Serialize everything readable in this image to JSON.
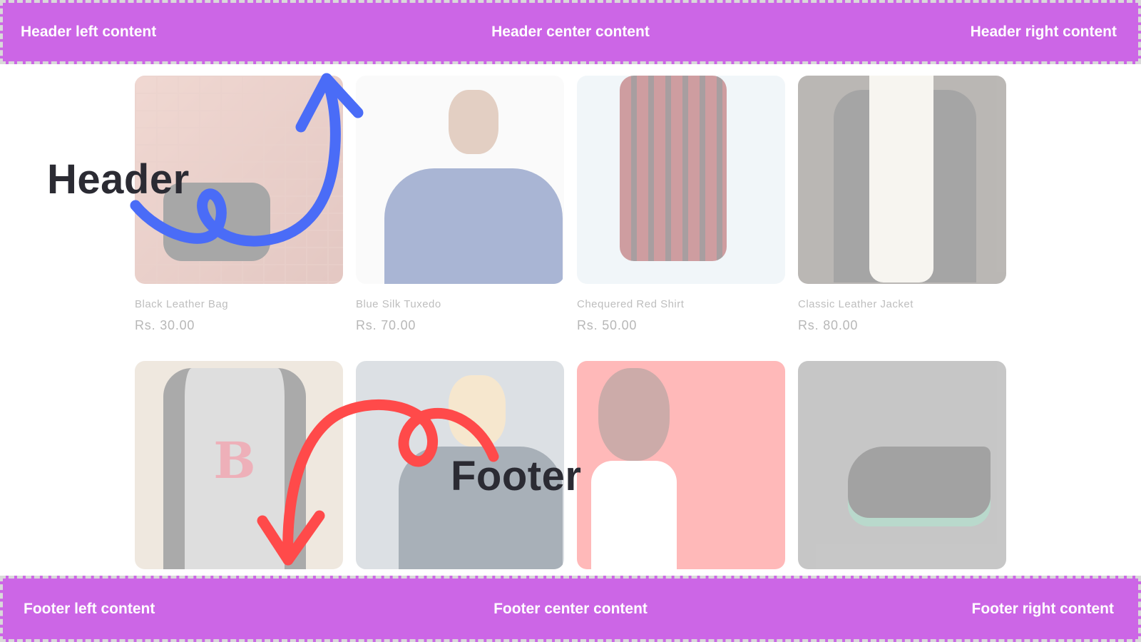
{
  "header": {
    "left": "Header left content",
    "center": "Header center content",
    "right": "Header right content",
    "label": "Header"
  },
  "footer": {
    "left": "Footer left content",
    "center": "Footer center content",
    "right": "Footer right content",
    "label": "Footer"
  },
  "products": [
    {
      "name": "Black Leather Bag",
      "price": "Rs. 30.00"
    },
    {
      "name": "Blue Silk Tuxedo",
      "price": "Rs. 70.00"
    },
    {
      "name": "Chequered Red Shirt",
      "price": "Rs. 50.00"
    },
    {
      "name": "Classic Leather Jacket",
      "price": "Rs. 80.00"
    }
  ],
  "colors": {
    "bar_background": "#cc66e6",
    "bar_text": "#ffffff",
    "header_arrow": "#4a6cf7",
    "footer_arrow": "#ff4a4a"
  }
}
